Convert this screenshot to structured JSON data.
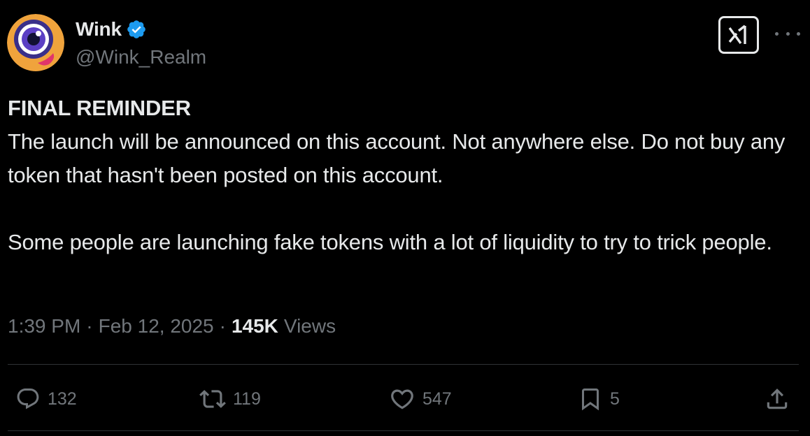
{
  "author": {
    "display_name": "Wink",
    "handle": "@Wink_Realm",
    "verified_icon": "verified-badge-icon",
    "avatar_icon": "wink-eye-avatar"
  },
  "header_actions": {
    "grok_icon": "grok-icon",
    "more_icon": "more-icon"
  },
  "tweet": {
    "heading": "FINAL REMINDER",
    "paragraph_1": "The launch will be announced on this account. Not anywhere else. Do not buy any token that hasn't been posted on this account.",
    "paragraph_2": "Some people are launching fake tokens with a lot of liquidity to try to trick people."
  },
  "meta": {
    "time": "1:39 PM",
    "separator": "·",
    "date": "Feb 12, 2025",
    "views_count": "145K",
    "views_label": "Views"
  },
  "actions": {
    "replies": "132",
    "reposts": "119",
    "likes": "547",
    "bookmarks": "5"
  },
  "colors": {
    "background": "#000000",
    "text_primary": "#e7e9ea",
    "text_secondary": "#71767b",
    "verified_blue": "#1d9bf0",
    "divider": "#2f3336"
  }
}
